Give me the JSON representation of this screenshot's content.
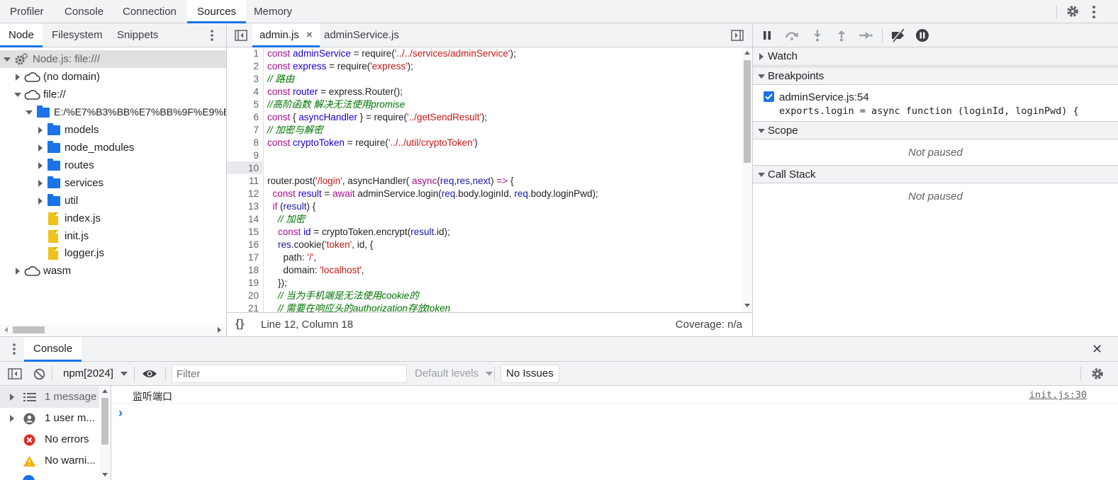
{
  "top_tabs": [
    "Profiler",
    "Console",
    "Connection",
    "Sources",
    "Memory"
  ],
  "top_active": "Sources",
  "navigator": {
    "tabs": [
      "Node",
      "Filesystem",
      "Snippets"
    ],
    "active": "Node",
    "tree": [
      {
        "label": "Node.js: file:///",
        "icon": "gear-icon"
      },
      {
        "label": "(no domain)",
        "icon": "cloud-icon"
      },
      {
        "label": "file://",
        "icon": "cloud-icon"
      },
      {
        "label": "E:/%E7%B3%BB%E7%BB%9F%E9%BB",
        "icon": "folder-icon"
      },
      {
        "label": "models",
        "icon": "folder-icon"
      },
      {
        "label": "node_modules",
        "icon": "folder-icon"
      },
      {
        "label": "routes",
        "icon": "folder-icon"
      },
      {
        "label": "services",
        "icon": "folder-icon"
      },
      {
        "label": "util",
        "icon": "folder-icon"
      },
      {
        "label": "index.js",
        "icon": "js-file-icon"
      },
      {
        "label": "init.js",
        "icon": "js-file-icon"
      },
      {
        "label": "logger.js",
        "icon": "js-file-icon"
      },
      {
        "label": "wasm",
        "icon": "cloud-icon"
      }
    ]
  },
  "editor": {
    "tabs": [
      "admin.js",
      "adminService.js"
    ],
    "active_tab": "admin.js",
    "close_glyph": "×",
    "highlighted_line": 10,
    "lines": [
      "const adminService = require('../../services/adminService');",
      "const express = require('express');",
      "// 路由",
      "const router = express.Router();",
      "//高阶函数 解决无法使用promise",
      "const { asyncHandler } = require('../getSendResult');",
      "// 加密与解密",
      "const cryptoToken = require('../../util/cryptoToken')",
      "",
      "",
      "router.post('/login', asyncHandler( async(req,res,next) => {",
      "  const result = await adminService.login(req.body.loginId, req.body.loginPwd);",
      "  if (result) {",
      "    // 加密",
      "    const id = cryptoToken.encrypt(result.id);",
      "    res.cookie('token', id, {",
      "      path: '/',",
      "      domain: 'localhost',",
      "    });",
      "    // 当为手机端是无法使用cookie的",
      "    // 需要在响应头的authorization存放token"
    ],
    "status_format_icon": "{}",
    "status_position": "Line 12, Column 18",
    "status_coverage": "Coverage: n/a"
  },
  "debugger": {
    "watch_label": "Watch",
    "breakpoints_label": "Breakpoints",
    "breakpoint_file": "adminService.js:54",
    "breakpoint_code": "exports.login = async function (loginId, loginPwd) {",
    "breakpoint_checked": true,
    "scope_label": "Scope",
    "scope_status": "Not paused",
    "callstack_label": "Call Stack",
    "callstack_status": "Not paused"
  },
  "drawer": {
    "tab": "Console",
    "close_glyph": "✕",
    "context": "npm[2024]",
    "filter_placeholder": "Filter",
    "levels": "Default levels",
    "issues": "No Issues",
    "sidebar": [
      {
        "label": "1 message",
        "icon": "list-icon"
      },
      {
        "label": "1 user m...",
        "icon": "user-icon"
      },
      {
        "label": "No errors",
        "icon": "error-icon"
      },
      {
        "label": "No warni...",
        "icon": "warning-icon"
      }
    ],
    "messages": [
      {
        "text": "监听端口",
        "source": "init.js:30"
      }
    ],
    "prompt": "›"
  },
  "colors": {
    "accent": "#1a73e8",
    "checkbox": "#1a73e8",
    "error": "#d93025",
    "warning": "#f9ab00"
  }
}
